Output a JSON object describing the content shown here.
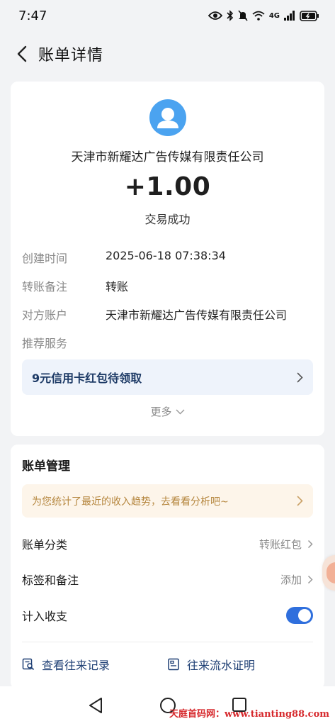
{
  "status_bar": {
    "time": "7:47",
    "network": "4G"
  },
  "header": {
    "title": "账单详情"
  },
  "transaction": {
    "merchant": "天津市新耀达广告传媒有限责任公司",
    "amount": "+1.00",
    "status": "交易成功",
    "details": [
      {
        "label": "创建时间",
        "value": "2025-06-18 07:38:34"
      },
      {
        "label": "转账备注",
        "value": "转账"
      },
      {
        "label": "对方账户",
        "value": "天津市新耀达广告传媒有限责任公司"
      },
      {
        "label": "推荐服务",
        "value": ""
      }
    ],
    "promo": "9元信用卡红包待领取",
    "more": "更多"
  },
  "manage": {
    "title": "账单管理",
    "trend_tip": "为您统计了最近的收入趋势，去看看分析吧~",
    "category_label": "账单分类",
    "category_value": "转账红包",
    "tags_label": "标签和备注",
    "tags_value": "添加",
    "include_label": "计入收支",
    "include_enabled": true,
    "history_link": "查看往来记录",
    "proof_link": "往来流水证明"
  },
  "watermark": "天庭首码网：www.tianting88.com",
  "colors": {
    "accent": "#2f6fdd",
    "avatar": "#4ba3f0",
    "promo_bg": "#eef3fb",
    "tip_bg": "#fdf5ea",
    "tip_text": "#b5863e",
    "watermark": "#d6282c"
  }
}
